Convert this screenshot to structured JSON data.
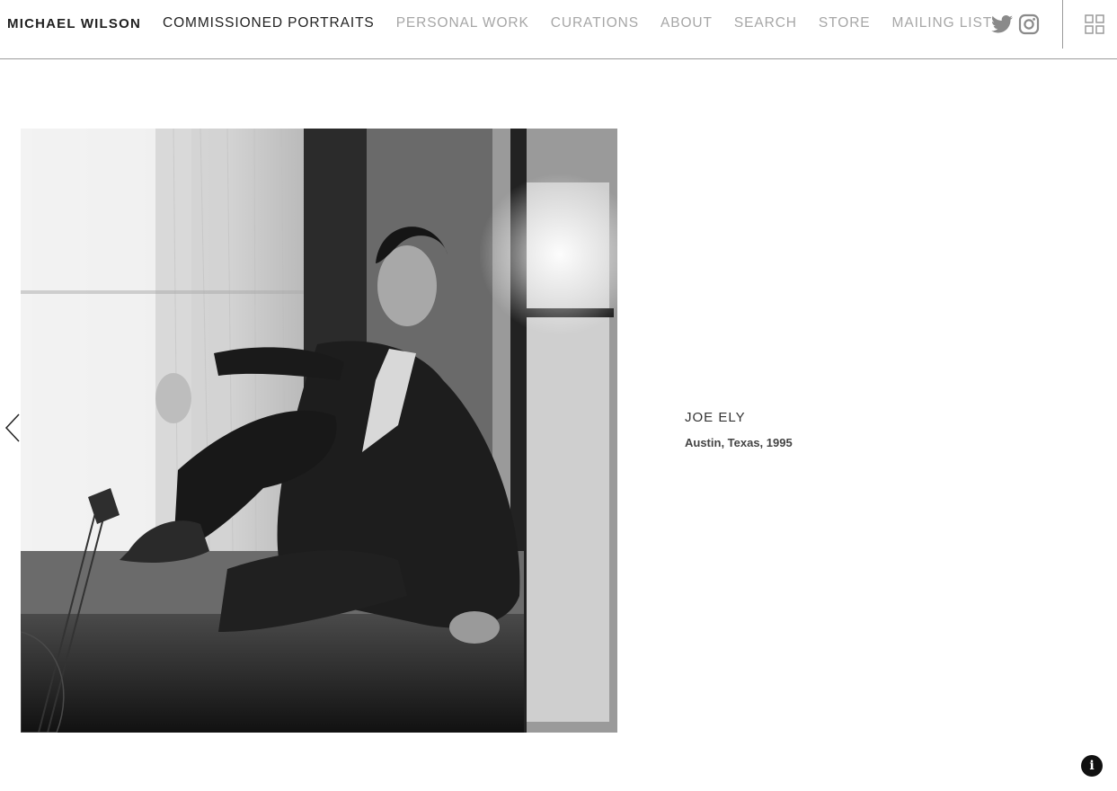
{
  "header": {
    "brand": "MICHAEL WILSON",
    "nav": [
      {
        "label": "COMMISSIONED PORTRAITS",
        "active": true
      },
      {
        "label": "PERSONAL WORK",
        "active": false
      },
      {
        "label": "CURATIONS",
        "active": false
      },
      {
        "label": "ABOUT",
        "active": false
      },
      {
        "label": "SEARCH",
        "active": false
      },
      {
        "label": "STORE",
        "active": false
      },
      {
        "label": "MAILING LIST",
        "active": false
      }
    ],
    "social_icons": [
      "twitter-icon",
      "instagram-icon"
    ],
    "grid_icon": "thumbnail-grid-icon"
  },
  "gallery": {
    "prev_icon": "chevron-left-icon",
    "photo_description_icon": "black-and-white-portrait-photo",
    "caption_title": "JOE ELY",
    "caption_subtitle": "Austin, Texas, 1995"
  },
  "info_button": {
    "label": "i",
    "icon": "info-icon"
  },
  "colors": {
    "nav_inactive": "#a6a6a6",
    "nav_active": "#222222",
    "divider": "#9a9a9a",
    "info_button_bg": "#111111"
  }
}
